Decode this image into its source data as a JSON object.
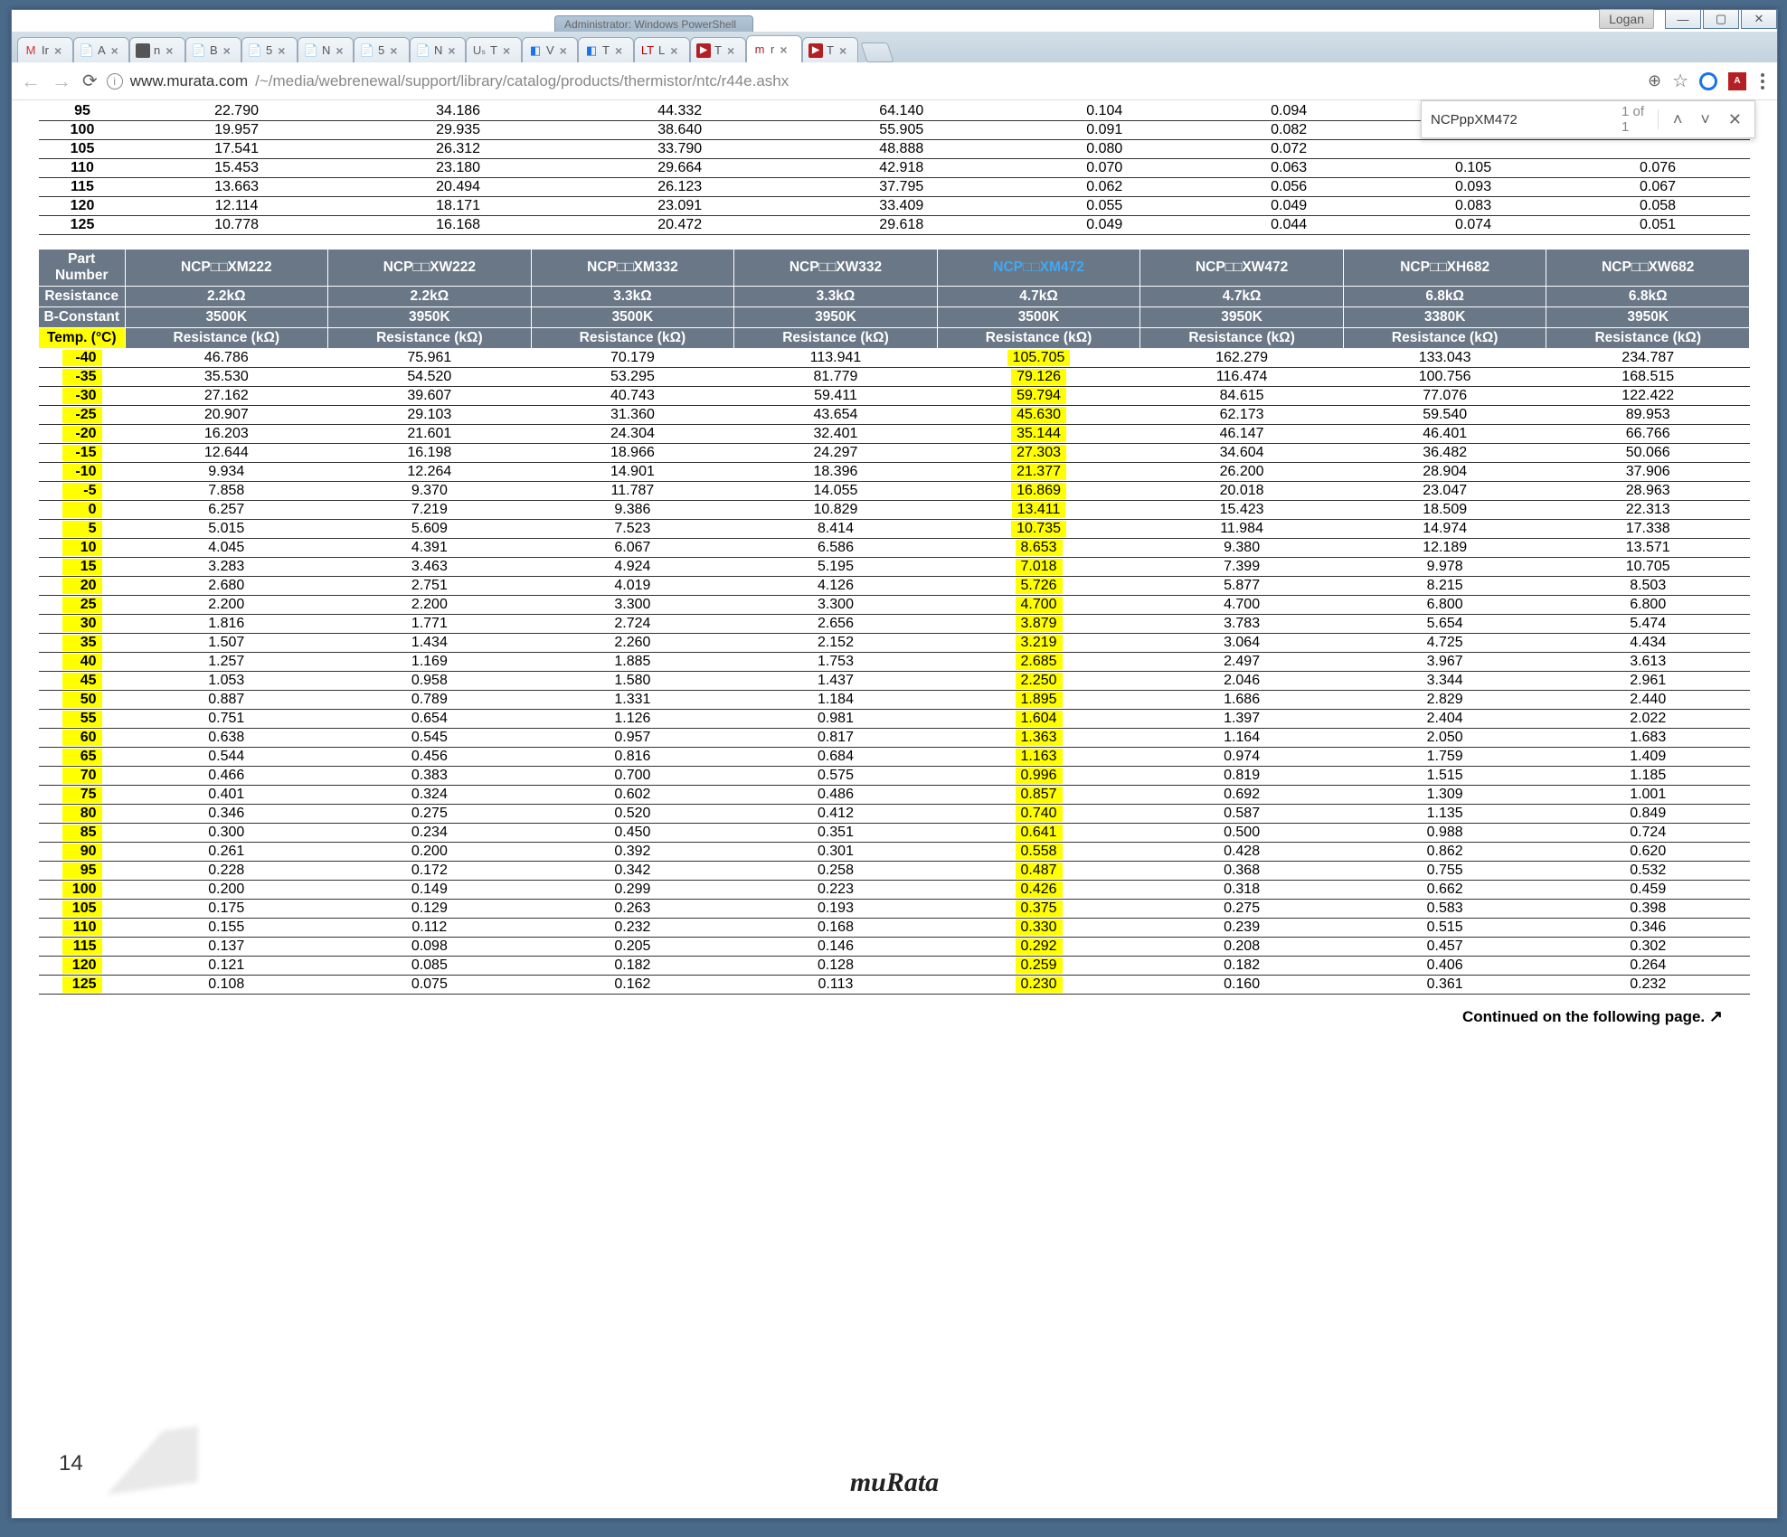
{
  "window": {
    "user": "Logan",
    "back_tab": "Administrator: Windows PowerShell"
  },
  "tabs": [
    {
      "icon": "M",
      "iconColor": "#d93025",
      "label": "Ir",
      "active": false
    },
    {
      "icon": "📄",
      "iconColor": "#4285f4",
      "label": "A",
      "active": false
    },
    {
      "icon": "S",
      "iconColor": "#555",
      "bg": "#555",
      "label": "n",
      "active": false
    },
    {
      "icon": "📄",
      "iconColor": "#4285f4",
      "label": "B",
      "active": false
    },
    {
      "icon": "📄",
      "iconColor": "#4285f4",
      "label": "5",
      "active": false
    },
    {
      "icon": "📄",
      "iconColor": "#888",
      "label": "N",
      "active": false
    },
    {
      "icon": "📄",
      "iconColor": "#888",
      "label": "5",
      "active": false
    },
    {
      "icon": "📄",
      "iconColor": "#888",
      "label": "N",
      "active": false
    },
    {
      "icon": "Uₛ",
      "iconColor": "#666",
      "label": "T",
      "active": false
    },
    {
      "icon": "◧",
      "iconColor": "#1a73e8",
      "label": "V",
      "active": false
    },
    {
      "icon": "◧",
      "iconColor": "#1a73e8",
      "label": "T",
      "active": false
    },
    {
      "icon": "LT",
      "iconColor": "#b00",
      "label": "L",
      "active": false
    },
    {
      "icon": "▶",
      "iconColor": "#fff",
      "bg": "#b51f24",
      "label": "T",
      "active": false
    },
    {
      "icon": "m",
      "iconColor": "#b51f24",
      "label": "r",
      "active": true
    },
    {
      "icon": "▶",
      "iconColor": "#fff",
      "bg": "#b51f24",
      "label": "T",
      "active": false
    }
  ],
  "url": {
    "host": "www.murata.com",
    "path": "/~/media/webrenewal/support/library/catalog/products/thermistor/ntc/r44e.ashx"
  },
  "find": {
    "query": "NCPppXM472",
    "count": "1 of 1"
  },
  "top_table": {
    "rows": [
      {
        "t": "95",
        "v": [
          "22.790",
          "34.186",
          "44.332",
          "64.140",
          "0.104",
          "0.094",
          "",
          ""
        ]
      },
      {
        "t": "100",
        "v": [
          "19.957",
          "29.935",
          "38.640",
          "55.905",
          "0.091",
          "0.082",
          "",
          ""
        ]
      },
      {
        "t": "105",
        "v": [
          "17.541",
          "26.312",
          "33.790",
          "48.888",
          "0.080",
          "0.072",
          "",
          ""
        ]
      },
      {
        "t": "110",
        "v": [
          "15.453",
          "23.180",
          "29.664",
          "42.918",
          "0.070",
          "0.063",
          "0.105",
          "0.076"
        ]
      },
      {
        "t": "115",
        "v": [
          "13.663",
          "20.494",
          "26.123",
          "37.795",
          "0.062",
          "0.056",
          "0.093",
          "0.067"
        ]
      },
      {
        "t": "120",
        "v": [
          "12.114",
          "18.171",
          "23.091",
          "33.409",
          "0.055",
          "0.049",
          "0.083",
          "0.058"
        ]
      },
      {
        "t": "125",
        "v": [
          "10.778",
          "16.168",
          "20.472",
          "29.618",
          "0.049",
          "0.044",
          "0.074",
          "0.051"
        ]
      }
    ]
  },
  "main_table": {
    "part_label": "Part Number",
    "res_label": "Resistance",
    "b_label": "B-Constant",
    "temp_label": "Temp. (°C)",
    "col_label": "Resistance (kΩ)",
    "parts": [
      "NCP□□XM222",
      "NCP□□XW222",
      "NCP□□XM332",
      "NCP□□XW332",
      "NCP□□XM472",
      "NCP□□XW472",
      "NCP□□XH682",
      "NCP□□XW682"
    ],
    "resist": [
      "2.2kΩ",
      "2.2kΩ",
      "3.3kΩ",
      "3.3kΩ",
      "4.7kΩ",
      "4.7kΩ",
      "6.8kΩ",
      "6.8kΩ"
    ],
    "bconst": [
      "3500K",
      "3950K",
      "3500K",
      "3950K",
      "3500K",
      "3950K",
      "3380K",
      "3950K"
    ],
    "rows": [
      {
        "t": "-40",
        "v": [
          "46.786",
          "75.961",
          "70.179",
          "113.941",
          "105.705",
          "162.279",
          "133.043",
          "234.787"
        ]
      },
      {
        "t": "-35",
        "v": [
          "35.530",
          "54.520",
          "53.295",
          "81.779",
          "79.126",
          "116.474",
          "100.756",
          "168.515"
        ]
      },
      {
        "t": "-30",
        "v": [
          "27.162",
          "39.607",
          "40.743",
          "59.411",
          "59.794",
          "84.615",
          "77.076",
          "122.422"
        ]
      },
      {
        "t": "-25",
        "v": [
          "20.907",
          "29.103",
          "31.360",
          "43.654",
          "45.630",
          "62.173",
          "59.540",
          "89.953"
        ]
      },
      {
        "t": "-20",
        "v": [
          "16.203",
          "21.601",
          "24.304",
          "32.401",
          "35.144",
          "46.147",
          "46.401",
          "66.766"
        ]
      },
      {
        "t": "-15",
        "v": [
          "12.644",
          "16.198",
          "18.966",
          "24.297",
          "27.303",
          "34.604",
          "36.482",
          "50.066"
        ]
      },
      {
        "t": "-10",
        "v": [
          "9.934",
          "12.264",
          "14.901",
          "18.396",
          "21.377",
          "26.200",
          "28.904",
          "37.906"
        ]
      },
      {
        "t": "-5",
        "v": [
          "7.858",
          "9.370",
          "11.787",
          "14.055",
          "16.869",
          "20.018",
          "23.047",
          "28.963"
        ]
      },
      {
        "t": "0",
        "v": [
          "6.257",
          "7.219",
          "9.386",
          "10.829",
          "13.411",
          "15.423",
          "18.509",
          "22.313"
        ]
      },
      {
        "t": "5",
        "v": [
          "5.015",
          "5.609",
          "7.523",
          "8.414",
          "10.735",
          "11.984",
          "14.974",
          "17.338"
        ]
      },
      {
        "t": "10",
        "v": [
          "4.045",
          "4.391",
          "6.067",
          "6.586",
          "8.653",
          "9.380",
          "12.189",
          "13.571"
        ]
      },
      {
        "t": "15",
        "v": [
          "3.283",
          "3.463",
          "4.924",
          "5.195",
          "7.018",
          "7.399",
          "9.978",
          "10.705"
        ]
      },
      {
        "t": "20",
        "v": [
          "2.680",
          "2.751",
          "4.019",
          "4.126",
          "5.726",
          "5.877",
          "8.215",
          "8.503"
        ]
      },
      {
        "t": "25",
        "v": [
          "2.200",
          "2.200",
          "3.300",
          "3.300",
          "4.700",
          "4.700",
          "6.800",
          "6.800"
        ]
      },
      {
        "t": "30",
        "v": [
          "1.816",
          "1.771",
          "2.724",
          "2.656",
          "3.879",
          "3.783",
          "5.654",
          "5.474"
        ]
      },
      {
        "t": "35",
        "v": [
          "1.507",
          "1.434",
          "2.260",
          "2.152",
          "3.219",
          "3.064",
          "4.725",
          "4.434"
        ]
      },
      {
        "t": "40",
        "v": [
          "1.257",
          "1.169",
          "1.885",
          "1.753",
          "2.685",
          "2.497",
          "3.967",
          "3.613"
        ]
      },
      {
        "t": "45",
        "v": [
          "1.053",
          "0.958",
          "1.580",
          "1.437",
          "2.250",
          "2.046",
          "3.344",
          "2.961"
        ]
      },
      {
        "t": "50",
        "v": [
          "0.887",
          "0.789",
          "1.331",
          "1.184",
          "1.895",
          "1.686",
          "2.829",
          "2.440"
        ]
      },
      {
        "t": "55",
        "v": [
          "0.751",
          "0.654",
          "1.126",
          "0.981",
          "1.604",
          "1.397",
          "2.404",
          "2.022"
        ]
      },
      {
        "t": "60",
        "v": [
          "0.638",
          "0.545",
          "0.957",
          "0.817",
          "1.363",
          "1.164",
          "2.050",
          "1.683"
        ]
      },
      {
        "t": "65",
        "v": [
          "0.544",
          "0.456",
          "0.816",
          "0.684",
          "1.163",
          "0.974",
          "1.759",
          "1.409"
        ]
      },
      {
        "t": "70",
        "v": [
          "0.466",
          "0.383",
          "0.700",
          "0.575",
          "0.996",
          "0.819",
          "1.515",
          "1.185"
        ]
      },
      {
        "t": "75",
        "v": [
          "0.401",
          "0.324",
          "0.602",
          "0.486",
          "0.857",
          "0.692",
          "1.309",
          "1.001"
        ]
      },
      {
        "t": "80",
        "v": [
          "0.346",
          "0.275",
          "0.520",
          "0.412",
          "0.740",
          "0.587",
          "1.135",
          "0.849"
        ]
      },
      {
        "t": "85",
        "v": [
          "0.300",
          "0.234",
          "0.450",
          "0.351",
          "0.641",
          "0.500",
          "0.988",
          "0.724"
        ]
      },
      {
        "t": "90",
        "v": [
          "0.261",
          "0.200",
          "0.392",
          "0.301",
          "0.558",
          "0.428",
          "0.862",
          "0.620"
        ]
      },
      {
        "t": "95",
        "v": [
          "0.228",
          "0.172",
          "0.342",
          "0.258",
          "0.487",
          "0.368",
          "0.755",
          "0.532"
        ]
      },
      {
        "t": "100",
        "v": [
          "0.200",
          "0.149",
          "0.299",
          "0.223",
          "0.426",
          "0.318",
          "0.662",
          "0.459"
        ]
      },
      {
        "t": "105",
        "v": [
          "0.175",
          "0.129",
          "0.263",
          "0.193",
          "0.375",
          "0.275",
          "0.583",
          "0.398"
        ]
      },
      {
        "t": "110",
        "v": [
          "0.155",
          "0.112",
          "0.232",
          "0.168",
          "0.330",
          "0.239",
          "0.515",
          "0.346"
        ]
      },
      {
        "t": "115",
        "v": [
          "0.137",
          "0.098",
          "0.205",
          "0.146",
          "0.292",
          "0.208",
          "0.457",
          "0.302"
        ]
      },
      {
        "t": "120",
        "v": [
          "0.121",
          "0.085",
          "0.182",
          "0.128",
          "0.259",
          "0.182",
          "0.406",
          "0.264"
        ]
      },
      {
        "t": "125",
        "v": [
          "0.108",
          "0.075",
          "0.162",
          "0.113",
          "0.230",
          "0.160",
          "0.361",
          "0.232"
        ]
      }
    ]
  },
  "continued": "Continued on the following page.",
  "page_number": "14",
  "logo": "muRata"
}
